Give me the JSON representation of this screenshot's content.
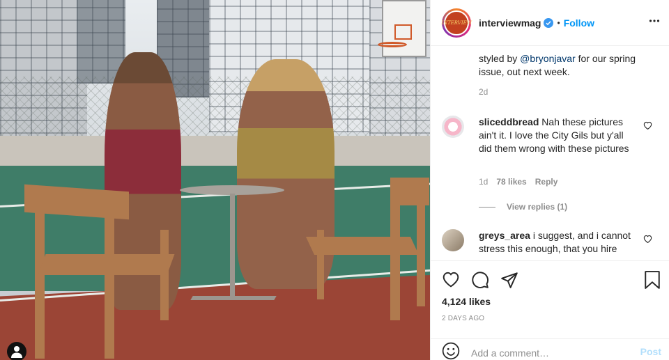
{
  "post": {
    "username": "interviewmag",
    "logo_text": "INTERVIEW",
    "follow_label": "Follow",
    "separator": "•",
    "caption_visible_fragment": "styled by",
    "caption_mention": "@bryonjavar",
    "caption_rest": " for our spring issue, out next week.",
    "caption_time": "2d"
  },
  "comments": [
    {
      "username": "sliceddbread",
      "text": " Nah these pictures ain't it. I love the City Gils but y'all did them wrong with these pictures",
      "time": "1d",
      "likes": "78 likes",
      "reply_label": "Reply",
      "view_replies": "View replies (1)"
    },
    {
      "username": "greys_area",
      "text": " i suggest, and i cannot stress this enough, that you hire"
    }
  ],
  "actions": {
    "likes": "4,124 likes",
    "date": "2 DAYS AGO"
  },
  "add_comment": {
    "placeholder": "Add a comment…",
    "post_label": "Post"
  },
  "colors": {
    "link": "#0095f6",
    "mention": "#00376b",
    "muted": "#8e8e8e",
    "post_disabled": "#b2dffc"
  }
}
